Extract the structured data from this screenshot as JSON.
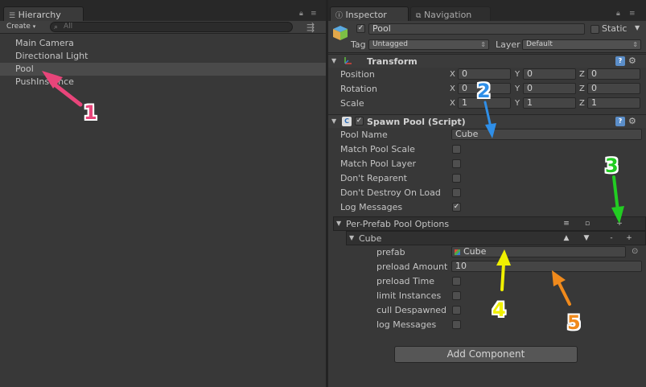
{
  "hierarchy": {
    "tab_label": "Hierarchy",
    "create_label": "Create",
    "search_placeholder": "All",
    "items": [
      {
        "label": "Main Camera"
      },
      {
        "label": "Directional Light"
      },
      {
        "label": "Pool",
        "selected": true
      },
      {
        "label": "PushInstance"
      }
    ]
  },
  "inspector": {
    "tabs": [
      {
        "label": "Inspector"
      },
      {
        "label": "Navigation"
      }
    ],
    "gameobject": {
      "name": "Pool",
      "active": true,
      "static_label": "Static",
      "static_checked": false,
      "tag_label": "Tag",
      "tag_value": "Untagged",
      "layer_label": "Layer",
      "layer_value": "Default"
    },
    "transform": {
      "title": "Transform",
      "rows": [
        {
          "label": "Position",
          "x": "0",
          "y": "0",
          "z": "0"
        },
        {
          "label": "Rotation",
          "x": "0",
          "y": "0",
          "z": "0"
        },
        {
          "label": "Scale",
          "x": "1",
          "y": "1",
          "z": "1"
        }
      ],
      "axis_labels": {
        "x": "X",
        "y": "Y",
        "z": "Z"
      }
    },
    "spawn_pool": {
      "title": "Spawn Pool (Script)",
      "pool_name_label": "Pool Name",
      "pool_name_value": "Cube",
      "toggles": [
        {
          "label": "Match Pool Scale",
          "checked": false
        },
        {
          "label": "Match Pool Layer",
          "checked": false
        },
        {
          "label": "Don't Reparent",
          "checked": false
        },
        {
          "label": "Don't Destroy On Load",
          "checked": false
        },
        {
          "label": "Log Messages",
          "checked": true
        }
      ],
      "per_prefab_label": "Per-Prefab Pool Options",
      "list_btn": "≡",
      "clear_btn": "▫",
      "add_btn": "+",
      "item": {
        "label": "Cube",
        "up_btn": "▲",
        "down_btn": "▼",
        "minus_btn": "-",
        "plus_btn": "+",
        "prefab_label": "prefab",
        "prefab_value": "Cube",
        "preload_amount_label": "preload Amount",
        "preload_amount_value": "10",
        "toggles": [
          {
            "label": "preload Time",
            "checked": false
          },
          {
            "label": "limit Instances",
            "checked": false
          },
          {
            "label": "cull Despawned",
            "checked": false
          },
          {
            "label": "log Messages",
            "checked": false
          }
        ]
      }
    },
    "add_component_label": "Add Component"
  },
  "annotations": [
    {
      "number": "1",
      "color": "#e8457a"
    },
    {
      "number": "2",
      "color": "#2f8fe8"
    },
    {
      "number": "3",
      "color": "#22cc22"
    },
    {
      "number": "4",
      "color": "#f0f000"
    },
    {
      "number": "5",
      "color": "#f08a1c"
    }
  ]
}
